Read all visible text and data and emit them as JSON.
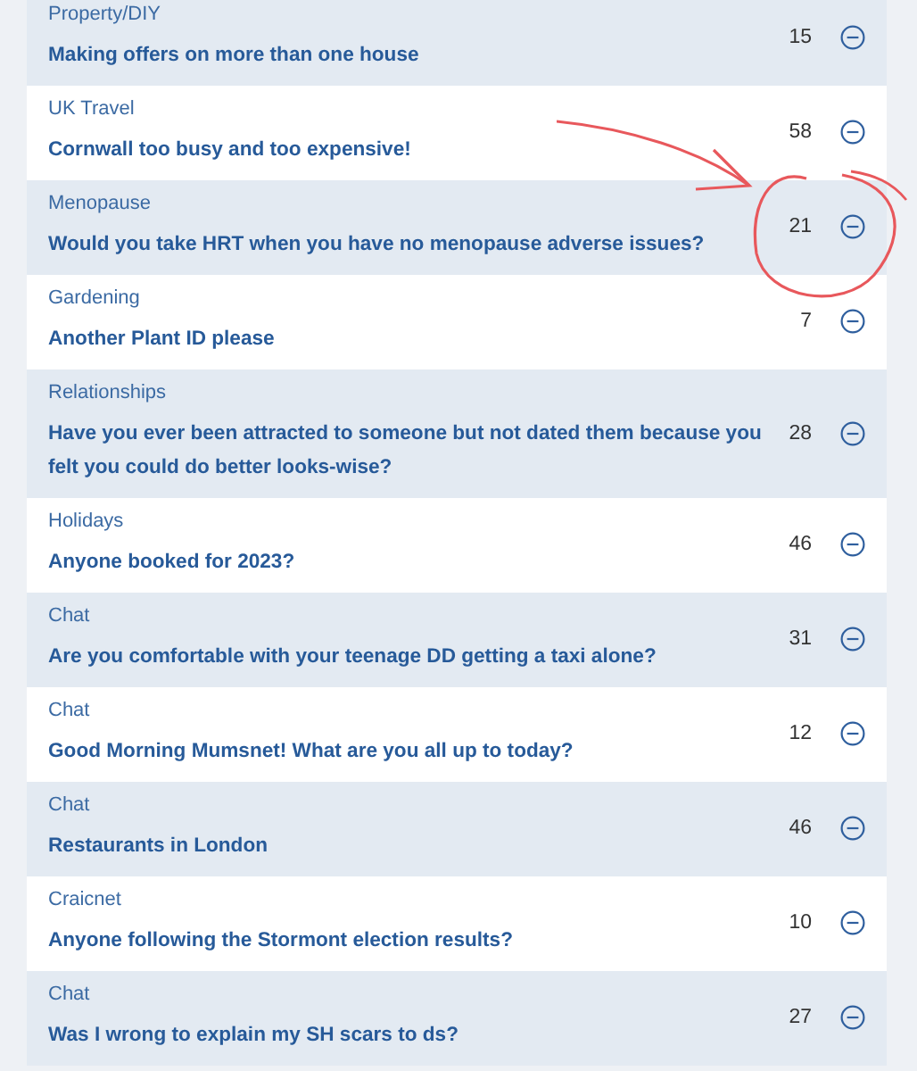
{
  "threads": [
    {
      "category": "Property/DIY",
      "title": "Making offers on more than one house",
      "count": "15"
    },
    {
      "category": "UK Travel",
      "title": "Cornwall too busy and too expensive!",
      "count": "58"
    },
    {
      "category": "Menopause",
      "title": "Would you take HRT when you have no menopause adverse issues?",
      "count": "21"
    },
    {
      "category": "Gardening",
      "title": "Another Plant ID please",
      "count": "7"
    },
    {
      "category": "Relationships",
      "title": "Have you ever been attracted to someone but not dated them because you felt you could do better looks-wise?",
      "count": "28"
    },
    {
      "category": "Holidays",
      "title": "Anyone booked for 2023?",
      "count": "46"
    },
    {
      "category": "Chat",
      "title": "Are you comfortable with your teenage DD getting a taxi alone?",
      "count": "31"
    },
    {
      "category": "Chat",
      "title": "Good Morning Mumsnet! What are you all up to today?",
      "count": "12"
    },
    {
      "category": "Chat",
      "title": "Restaurants in London",
      "count": "46"
    },
    {
      "category": "Craicnet",
      "title": "Anyone following the Stormont election results?",
      "count": "10"
    },
    {
      "category": "Chat",
      "title": "Was I wrong to explain my SH scars to ds?",
      "count": "27"
    }
  ]
}
